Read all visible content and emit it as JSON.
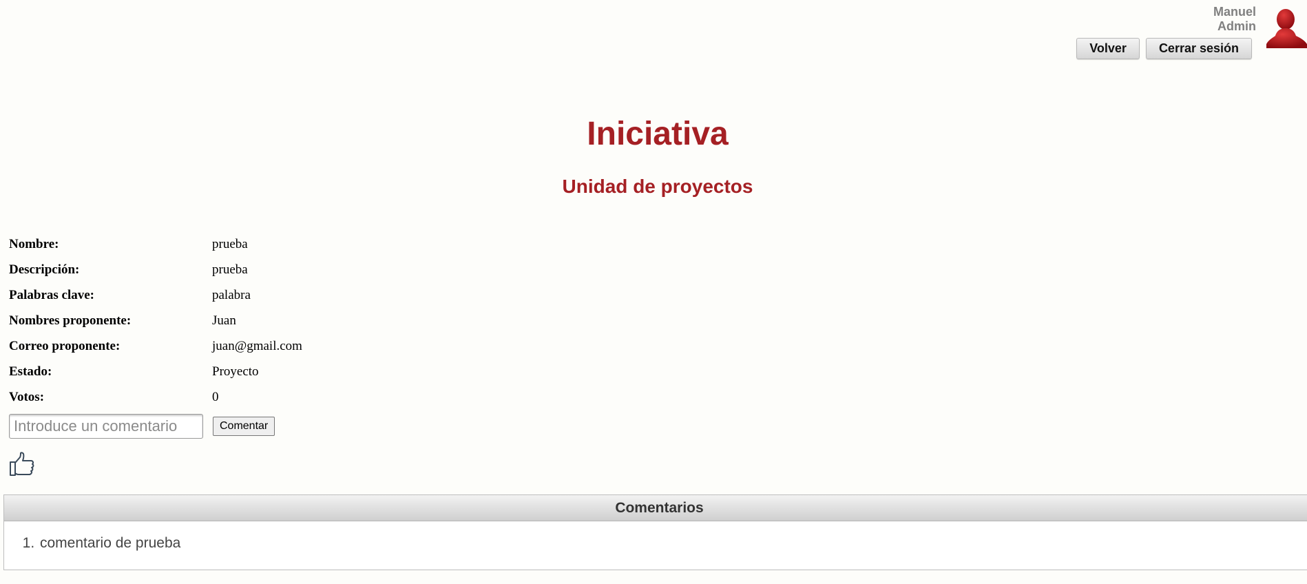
{
  "header": {
    "user_first_name": "Manuel",
    "user_role": "Admin",
    "back_label": "Volver",
    "logout_label": "Cerrar sesión"
  },
  "page": {
    "title": "Iniciativa",
    "subtitle": "Unidad de proyectos"
  },
  "details": [
    {
      "label": "Nombre:",
      "value": "prueba"
    },
    {
      "label": "Descripción:",
      "value": "prueba"
    },
    {
      "label": "Palabras clave:",
      "value": "palabra"
    },
    {
      "label": "Nombres proponente:",
      "value": "Juan"
    },
    {
      "label": "Correo proponente:",
      "value": "juan@gmail.com"
    },
    {
      "label": "Estado:",
      "value": "Proyecto"
    },
    {
      "label": "Votos:",
      "value": "0"
    }
  ],
  "comment_form": {
    "placeholder": "Introduce un comentario",
    "value": "",
    "submit_label": "Comentar"
  },
  "like": {
    "icon": "thumbs-up-icon"
  },
  "comments": {
    "header": "Comentarios",
    "items": [
      "comentario de prueba"
    ]
  },
  "colors": {
    "accent": "#a52024",
    "avatar": "#b01218",
    "muted_text": "#808080"
  }
}
